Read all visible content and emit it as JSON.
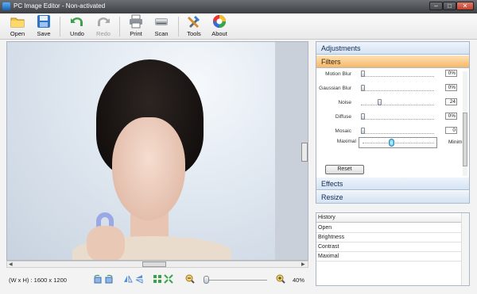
{
  "window": {
    "title": "PC Image Editor - Non-activated",
    "controls": {
      "minimize": "–",
      "maximize": "□",
      "close": "✕"
    }
  },
  "toolbar": {
    "open": "Open",
    "save": "Save",
    "undo": "Undo",
    "redo": "Redo",
    "print": "Print",
    "scan": "Scan",
    "tools": "Tools",
    "about": "About"
  },
  "status": {
    "dimensions": "(W x H) : 1600 x 1200",
    "zoom": "40%"
  },
  "panel": {
    "adjustments": "Adjustments",
    "filters": "Filters",
    "effects": "Effects",
    "resize": "Resize",
    "reset": "Reset"
  },
  "filters": [
    {
      "label": "Motion Blur",
      "value": "0%",
      "level": 0
    },
    {
      "label": "Gaussian Blur",
      "value": "0%",
      "level": 0
    },
    {
      "label": "Noise",
      "value": "24",
      "level": 0.24
    },
    {
      "label": "Diffuse",
      "value": "0%",
      "level": 0
    },
    {
      "label": "Mosaic",
      "value": "0",
      "level": 0
    }
  ],
  "maximal": {
    "label": "Maximal",
    "right_label": "Minim",
    "level": 0.4
  },
  "history": {
    "header": "History",
    "items": [
      "Open",
      "Brightness",
      "Contrast",
      "Maximal"
    ]
  },
  "colors": {
    "accent_active": "#f7b866",
    "accordion": "#d5e3f2",
    "titlebar": "#3c3f43"
  }
}
